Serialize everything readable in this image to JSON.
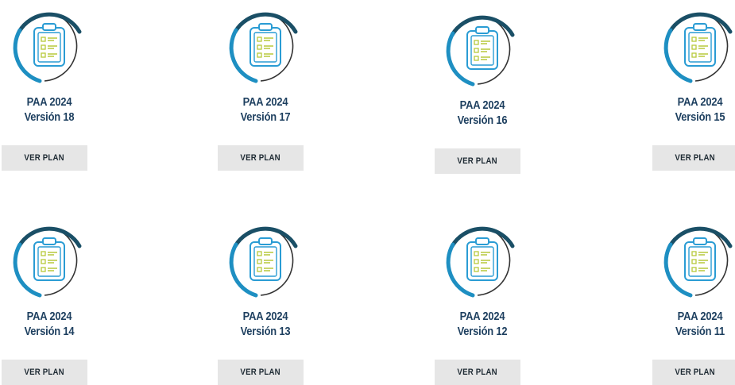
{
  "colors": {
    "arc_dark": "#1a4f66",
    "arc_blue": "#1e8fc2",
    "arc_thin": "#333333",
    "clipboard": "#2a9cd4",
    "list_lines": "#b7c93a",
    "title_text": "#1d3f5f",
    "button_bg": "#e6e6e6"
  },
  "icon_name": "clipboard-checklist-icon",
  "plans": [
    {
      "year_label": "PAA 2024",
      "version_label": "Versión 18",
      "button_label": "VER PLAN"
    },
    {
      "year_label": "PAA 2024",
      "version_label": "Versión 17",
      "button_label": "VER PLAN"
    },
    {
      "year_label": "PAA 2024",
      "version_label": "Versión 16",
      "button_label": "VER PLAN"
    },
    {
      "year_label": "PAA 2024",
      "version_label": "Versión 15",
      "button_label": "VER PLAN"
    },
    {
      "year_label": "PAA 2024",
      "version_label": "Versión 14",
      "button_label": "VER PLAN"
    },
    {
      "year_label": "PAA 2024",
      "version_label": "Versión 13",
      "button_label": "VER PLAN"
    },
    {
      "year_label": "PAA 2024",
      "version_label": "Versión 12",
      "button_label": "VER PLAN"
    },
    {
      "year_label": "PAA 2024",
      "version_label": "Versión 11",
      "button_label": "VER PLAN"
    }
  ]
}
